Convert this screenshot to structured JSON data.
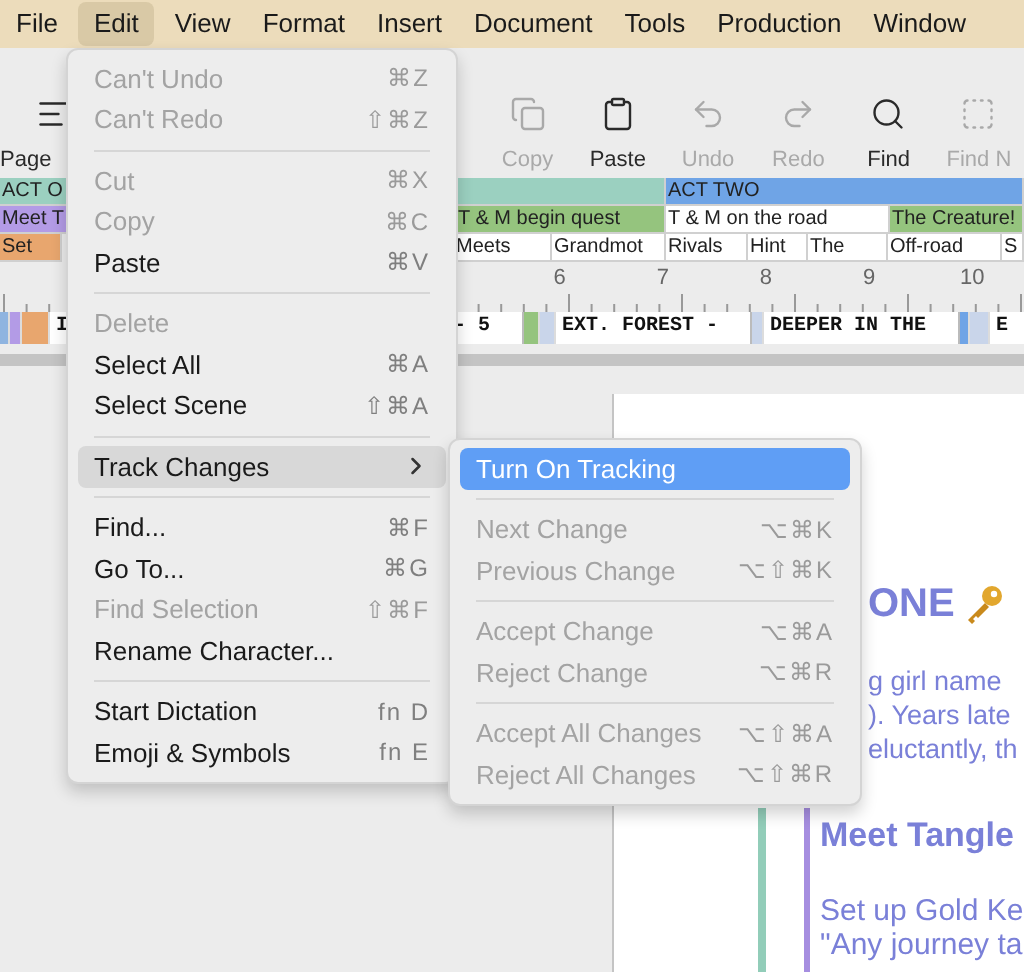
{
  "menu_bar": [
    {
      "label": "File",
      "selected": false
    },
    {
      "label": "Edit",
      "selected": true
    },
    {
      "label": "View",
      "selected": false
    },
    {
      "label": "Format",
      "selected": false
    },
    {
      "label": "Insert",
      "selected": false
    },
    {
      "label": "Document",
      "selected": false
    },
    {
      "label": "Tools",
      "selected": false
    },
    {
      "label": "Production",
      "selected": false
    },
    {
      "label": "Window",
      "selected": false
    }
  ],
  "toolbar": [
    {
      "label": "Page",
      "disabled": false
    },
    {
      "label": "Copy",
      "disabled": true
    },
    {
      "label": "Paste",
      "disabled": false
    },
    {
      "label": "Undo",
      "disabled": true
    },
    {
      "label": "Redo",
      "disabled": true
    },
    {
      "label": "Find",
      "disabled": false
    },
    {
      "label": "Find N",
      "disabled": true
    }
  ],
  "timeline": {
    "acts": [
      {
        "label": "ACT O",
        "color": "#9bd0c0"
      },
      {
        "label": "ACT TWO",
        "color": "#6fa4e6"
      }
    ],
    "sequences": [
      {
        "label": "Meet T",
        "color": "#b39be6"
      },
      {
        "label": "T & M begin quest",
        "color": "#95c47e"
      },
      {
        "label": "T & M on the road",
        "color": "#ffffff"
      },
      {
        "label": "The Creature!",
        "color": "#95c47e"
      }
    ],
    "scenes": [
      {
        "label": "Set",
        "color": "#e8a66e"
      },
      {
        "label": "Meets",
        "color": "#ffffff"
      },
      {
        "label": "Grandmot",
        "color": "#ffffff"
      },
      {
        "label": "Rivals",
        "color": "#ffffff"
      },
      {
        "label": "Hint",
        "color": "#ffffff"
      },
      {
        "label": "The",
        "color": "#ffffff"
      },
      {
        "label": "Off-road",
        "color": "#ffffff"
      },
      {
        "label": "S",
        "color": "#ffffff"
      }
    ]
  },
  "ruler": [
    "6",
    "7",
    "8",
    "9",
    "10"
  ],
  "scene_strip": [
    {
      "kind": "block",
      "color": "#8fb4e0"
    },
    {
      "kind": "block",
      "color": "#b39be6"
    },
    {
      "kind": "block",
      "color": "#e8a66e"
    },
    {
      "kind": "heading",
      "label": "I"
    },
    {
      "kind": "heading",
      "label": "- 5"
    },
    {
      "kind": "block",
      "color": "#95c47e"
    },
    {
      "kind": "block",
      "color": "#c9d5ea"
    },
    {
      "kind": "heading",
      "label": "EXT. FOREST -"
    },
    {
      "kind": "block",
      "color": "#c9d5ea"
    },
    {
      "kind": "heading",
      "label": "DEEPER IN THE"
    },
    {
      "kind": "block",
      "color": "#6fa4e6"
    },
    {
      "kind": "block",
      "color": "#c9d5ea"
    },
    {
      "kind": "heading",
      "label": "E"
    }
  ],
  "document": {
    "title": "ONE",
    "lines": [
      "g girl name",
      "). Years late",
      "eluctantly, th"
    ],
    "heading": "Meet Tangle",
    "body": [
      "Set up Gold Ke",
      "\"Any journey ta"
    ]
  },
  "edit_menu": {
    "sections": [
      [
        {
          "label": "Can't Undo",
          "shortcut": "⌘Z",
          "disabled": true,
          "selected": false
        },
        {
          "label": "Can't Redo",
          "shortcut": "⇧⌘Z",
          "disabled": true,
          "selected": false
        }
      ],
      [
        {
          "label": "Cut",
          "shortcut": "⌘X",
          "disabled": true,
          "selected": false
        },
        {
          "label": "Copy",
          "shortcut": "⌘C",
          "disabled": true,
          "selected": false
        },
        {
          "label": "Paste",
          "shortcut": "⌘V",
          "disabled": false,
          "selected": false
        }
      ],
      [
        {
          "label": "Delete",
          "disabled": true,
          "selected": false
        },
        {
          "label": "Select All",
          "shortcut": "⌘A",
          "disabled": false,
          "selected": false
        },
        {
          "label": "Select Scene",
          "shortcut": "⇧⌘A",
          "disabled": false,
          "selected": false
        }
      ],
      [
        {
          "label": "Track Changes",
          "submenu": true,
          "disabled": false,
          "selected": true
        }
      ],
      [
        {
          "label": "Find...",
          "shortcut": "⌘F",
          "disabled": false,
          "selected": false
        },
        {
          "label": "Go To...",
          "shortcut": "⌘G",
          "disabled": false,
          "selected": false
        },
        {
          "label": "Find Selection",
          "shortcut": "⇧⌘F",
          "disabled": true,
          "selected": false
        },
        {
          "label": "Rename Character...",
          "disabled": false,
          "selected": false
        }
      ],
      [
        {
          "label": "Start Dictation",
          "shortcut": "fn D",
          "disabled": false,
          "selected": false
        },
        {
          "label": "Emoji & Symbols",
          "shortcut": "fn E",
          "disabled": false,
          "selected": false
        }
      ]
    ]
  },
  "track_changes_menu": {
    "sections": [
      [
        {
          "label": "Turn On Tracking",
          "disabled": false,
          "selected": true
        }
      ],
      [
        {
          "label": "Next Change",
          "shortcut": "⌥⌘K",
          "disabled": true,
          "selected": false
        },
        {
          "label": "Previous Change",
          "shortcut": "⌥⇧⌘K",
          "disabled": true,
          "selected": false
        }
      ],
      [
        {
          "label": "Accept Change",
          "shortcut": "⌥⌘A",
          "disabled": true,
          "selected": false
        },
        {
          "label": "Reject Change",
          "shortcut": "⌥⌘R",
          "disabled": true,
          "selected": false
        }
      ],
      [
        {
          "label": "Accept All Changes",
          "shortcut": "⌥⇧⌘A",
          "disabled": true,
          "selected": false
        },
        {
          "label": "Reject All Changes",
          "shortcut": "⌥⇧⌘R",
          "disabled": true,
          "selected": false
        }
      ]
    ]
  }
}
